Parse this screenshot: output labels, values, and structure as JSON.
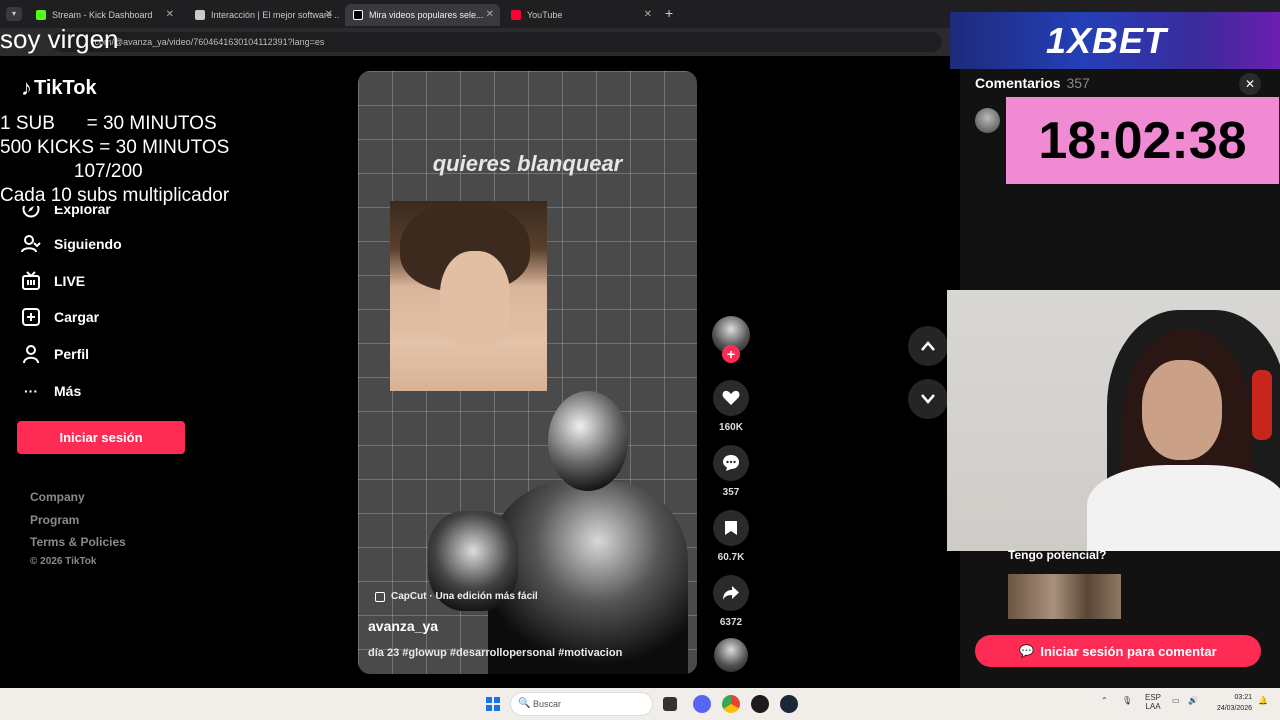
{
  "browser": {
    "tabs": [
      {
        "label": "Stream - Kick Dashboard",
        "color": "#53fc18"
      },
      {
        "label": "Interacción | El mejor software ...",
        "color": "#c9c9c9"
      },
      {
        "label": "Mira videos populares sele...",
        "color": "#ffffff"
      },
      {
        "label": "YouTube",
        "color": "#ff0033"
      }
    ],
    "url": ".com/@avanza_ya/video/7604641630104112391?lang=es"
  },
  "overlay": {
    "title": "soy virgen",
    "lines": [
      "1 SUB      = 30 MINUTOS",
      "500 KICKS = 30 MINUTOS",
      "              107/200",
      "Cada 10 subs multiplicador"
    ]
  },
  "sidebar": {
    "logo": "TikTok",
    "items": [
      {
        "label": "Explorar",
        "icon": "compass-icon"
      },
      {
        "label": "Siguiendo",
        "icon": "following-icon"
      },
      {
        "label": "LIVE",
        "icon": "live-icon"
      },
      {
        "label": "Cargar",
        "icon": "upload-icon"
      },
      {
        "label": "Perfil",
        "icon": "profile-icon"
      },
      {
        "label": "Más",
        "icon": "more-icon"
      }
    ],
    "login_label": "Iniciar sesión",
    "footer": [
      "Company",
      "Program",
      "Terms & Policies"
    ],
    "copyright": "© 2026 TikTok"
  },
  "video": {
    "caption": "quieres blanquear",
    "capcut_label": "CapCut · Una edición más fácil",
    "author": "avanza_ya",
    "description": "día 23 #glowup #desarrollopersonal #motivacion"
  },
  "actions": {
    "likes": "160K",
    "comments": "357",
    "saves": "60.7K",
    "shares": "6372"
  },
  "ad": {
    "text": "1XBET"
  },
  "comments": {
    "title": "Comentarios",
    "count": "357",
    "timer": "18:02:38",
    "comment_text": "Tengo potencial?",
    "cta_label": "Iniciar sesión para comentar"
  },
  "taskbar": {
    "search_placeholder": "Buscar",
    "lang1": "ESP",
    "lang2": "LAA",
    "time": "03:21",
    "date": "24/03/2026"
  },
  "colors": {
    "accent": "#fe2c55",
    "timer_bg": "#f08bd3"
  }
}
